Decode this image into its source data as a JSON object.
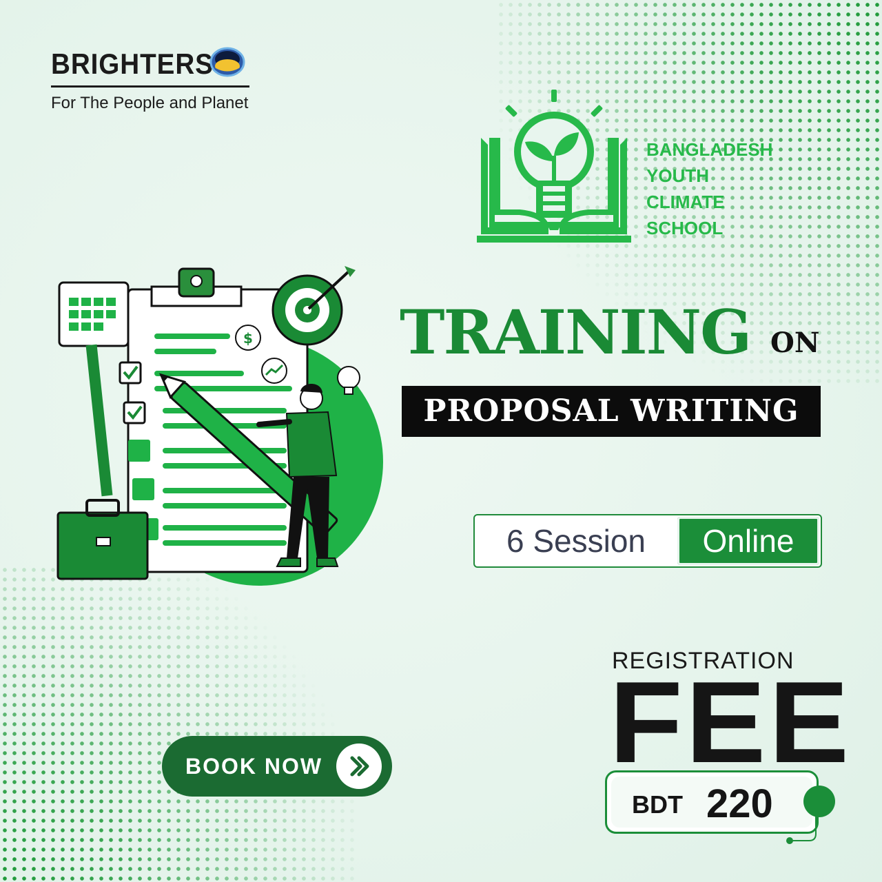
{
  "brand": {
    "name": "BRIGHTERS",
    "tagline": "For The People and Planet",
    "logo_icon": "globe-logo-icon"
  },
  "school": {
    "lines": [
      "BANGLADESH",
      "YOUTH",
      "CLIMATE",
      "SCHOOL"
    ],
    "logo_icon": "lightbulb-book-icon",
    "color": "#27b94a"
  },
  "title": {
    "main": "TRAINING",
    "connector": "ON",
    "subject": "PROPOSAL WRITING"
  },
  "session": {
    "count_label": "6 Session",
    "mode_label": "Online"
  },
  "fee": {
    "label": "REGISTRATION",
    "big": "FEE",
    "currency": "BDT",
    "amount": "220"
  },
  "cta": {
    "label": "BOOK NOW",
    "icon": "double-chevron-right-icon"
  },
  "colors": {
    "accent": "#1b8e39",
    "bright_green": "#27b94a",
    "dark": "#0c0c0c",
    "background": "#e8f5ee"
  }
}
